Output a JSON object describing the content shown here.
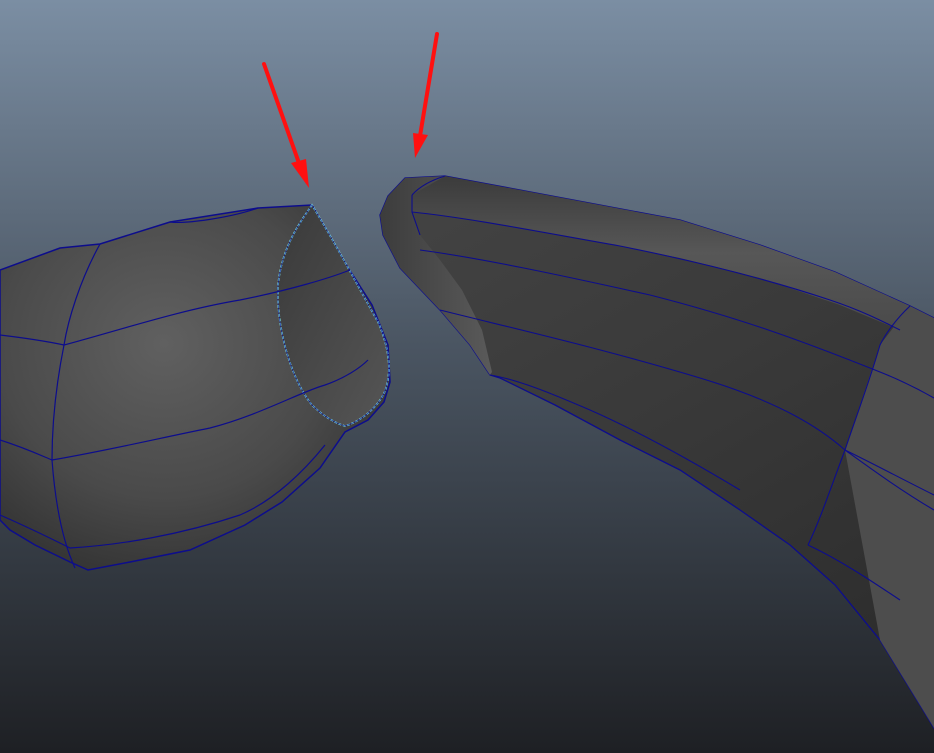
{
  "viewport": {
    "background_top": "#7b8ea3",
    "background_mid": "#4b5663",
    "background_bottom": "#1e2024"
  },
  "mesh": {
    "shading_light": "#5f5f5f",
    "shading_mid": "#474747",
    "shading_dark": "#2c2c2c",
    "wireframe_color": "#0d0d8c",
    "selected_border_color": "#7fe6e6"
  },
  "annotations": {
    "arrow_color": "#ff1010",
    "arrow_count": 2
  }
}
